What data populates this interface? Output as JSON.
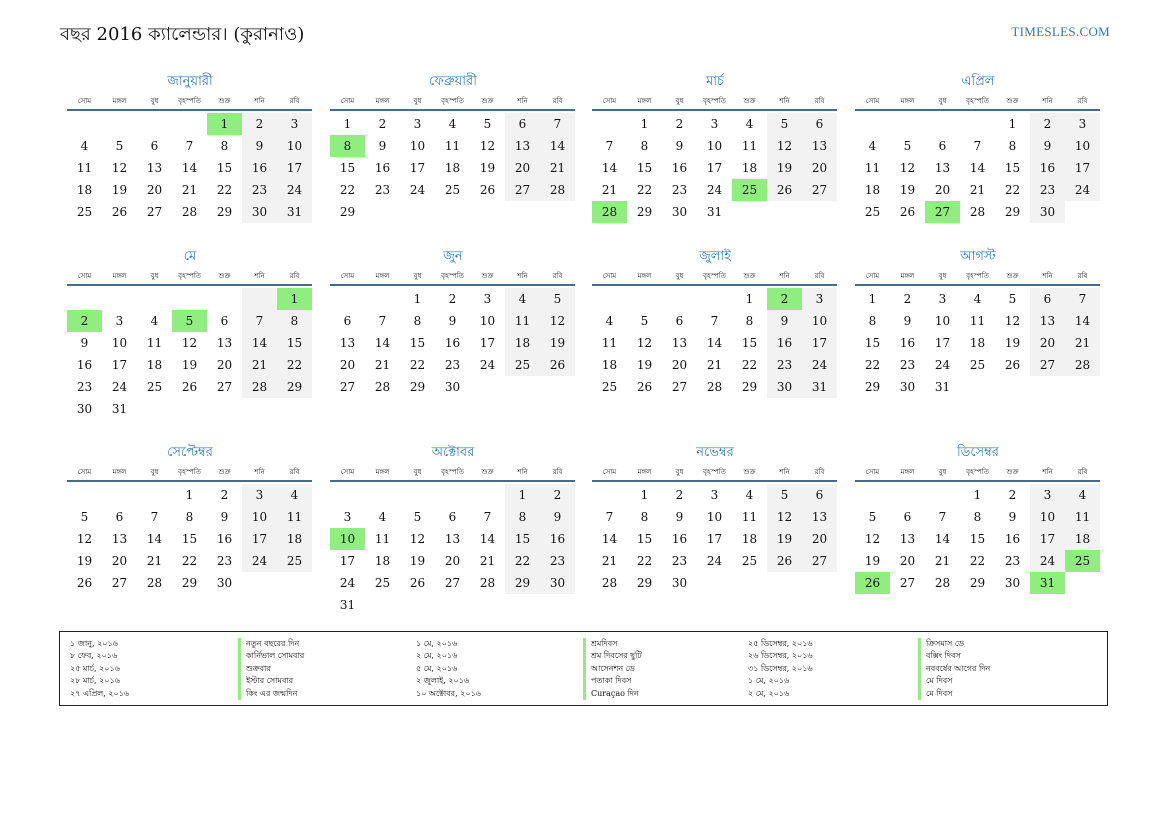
{
  "header": {
    "title": "বছর 2016 ক্যালেন্ডার। (কুরানাও)",
    "brand": "TIMESLES.COM"
  },
  "day_names": [
    "সোম",
    "মঙ্গল",
    "বুধ",
    "বৃহস্পতি",
    "শুক্র",
    "শনি",
    "রবি"
  ],
  "colors": {
    "holiday": "#90ee80",
    "weekend": "#f2f2f2",
    "accent": "#2a7ab8"
  },
  "months": [
    {
      "name": "জানুয়ারী",
      "offset": 4,
      "days": 31,
      "holidays": [
        1
      ]
    },
    {
      "name": "ফেব্রুয়ারী",
      "offset": 0,
      "days": 29,
      "holidays": [
        8
      ]
    },
    {
      "name": "মার্চ",
      "offset": 1,
      "days": 31,
      "holidays": [
        25,
        28
      ]
    },
    {
      "name": "এপ্রিল",
      "offset": 4,
      "days": 30,
      "holidays": [
        27
      ]
    },
    {
      "name": "মে",
      "offset": 6,
      "days": 31,
      "holidays": [
        1,
        2,
        5
      ]
    },
    {
      "name": "জুন",
      "offset": 2,
      "days": 30,
      "holidays": []
    },
    {
      "name": "জুলাই",
      "offset": 4,
      "days": 31,
      "holidays": [
        2
      ]
    },
    {
      "name": "আগস্ট",
      "offset": 0,
      "days": 31,
      "holidays": []
    },
    {
      "name": "সেপ্টেম্বর",
      "offset": 3,
      "days": 30,
      "holidays": []
    },
    {
      "name": "অক্টোবর",
      "offset": 5,
      "days": 31,
      "holidays": [
        10
      ]
    },
    {
      "name": "নভেম্বর",
      "offset": 1,
      "days": 30,
      "holidays": []
    },
    {
      "name": "ডিসেম্বর",
      "offset": 3,
      "days": 31,
      "holidays": [
        25,
        26,
        31
      ]
    }
  ],
  "holiday_list": {
    "col1_dates": [
      "১ জানু, ২০১৬",
      "৮ ফেব, ২০১৬",
      "২৫ মার্চ, ২০১৬",
      "২৮ মার্চ, ২০১৬",
      "২৭ এপ্রিল, ২০১৬"
    ],
    "col1_names": [
      "নতুন বছরের দিন",
      "কার্নিভাল সোমবার",
      "শুক্রবার",
      "ইস্টার সোমবার",
      "কিং এর জন্মদিন"
    ],
    "col2_dates": [
      "১ মে, ২০১৬",
      "২ মে, ২০১৬",
      "৫ মে, ২০১৬",
      "২ জুলাই, ২০১৬",
      "১০ অক্টোবর, ২০১৬"
    ],
    "col2_names": [
      "শ্রমদিবস",
      "শ্রম দিবসের ছুটি",
      "আসেনশন ডে",
      "পতাকা দিবস",
      "Curaçao দিন"
    ],
    "col3_dates": [
      "২৫ ডিসেম্বর, ২০১৬",
      "২৬ ডিসেম্বর, ২০১৬",
      "৩১ ডিসেম্বর, ২০১৬",
      "১ মে, ২০১৬",
      "২ মে, ২০১৬"
    ],
    "col3_names": [
      "ক্রিসমাস ডে",
      "বক্সিং দিবস",
      "নববর্ষের আগের দিন",
      "মে দিবস",
      "মে দিবস"
    ]
  }
}
